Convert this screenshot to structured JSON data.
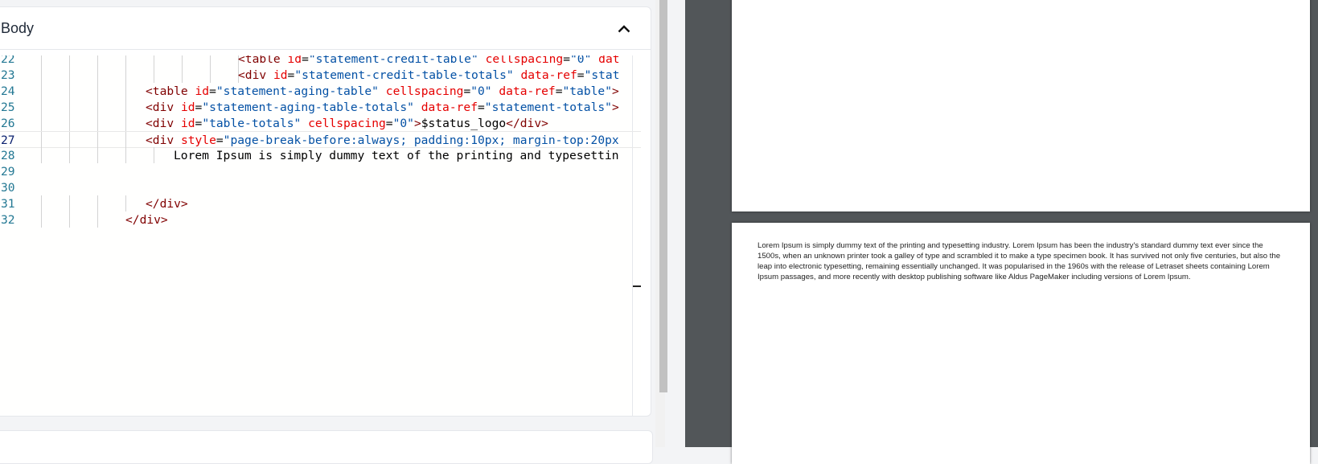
{
  "panel": {
    "title": "Body",
    "collapse_icon": "chevron-up-icon"
  },
  "editor": {
    "lines": [
      {
        "num": "22",
        "indent": 8,
        "parts": [
          {
            "t": "tag",
            "v": "<table "
          },
          {
            "t": "attr",
            "v": "id"
          },
          {
            "t": "txt",
            "v": "="
          },
          {
            "t": "val",
            "v": "\"statement-credit-table\""
          },
          {
            "t": "txt",
            "v": " "
          },
          {
            "t": "attr",
            "v": "cellspacing"
          },
          {
            "t": "txt",
            "v": "="
          },
          {
            "t": "val",
            "v": "\"0\""
          },
          {
            "t": "txt",
            "v": " "
          },
          {
            "t": "attr",
            "v": "dat"
          }
        ]
      },
      {
        "num": "23",
        "indent": 8,
        "parts": [
          {
            "t": "tag",
            "v": "<div "
          },
          {
            "t": "attr",
            "v": "id"
          },
          {
            "t": "txt",
            "v": "="
          },
          {
            "t": "val",
            "v": "\"statement-credit-table-totals\""
          },
          {
            "t": "txt",
            "v": " "
          },
          {
            "t": "attr",
            "v": "data-ref"
          },
          {
            "t": "txt",
            "v": "="
          },
          {
            "t": "val",
            "v": "\"stat"
          }
        ]
      },
      {
        "num": "24",
        "indent": 4,
        "parts": [
          {
            "t": "tag",
            "v": "<table "
          },
          {
            "t": "attr",
            "v": "id"
          },
          {
            "t": "txt",
            "v": "="
          },
          {
            "t": "val",
            "v": "\"statement-aging-table\""
          },
          {
            "t": "txt",
            "v": " "
          },
          {
            "t": "attr",
            "v": "cellspacing"
          },
          {
            "t": "txt",
            "v": "="
          },
          {
            "t": "val",
            "v": "\"0\""
          },
          {
            "t": "txt",
            "v": " "
          },
          {
            "t": "attr",
            "v": "data-ref"
          },
          {
            "t": "txt",
            "v": "="
          },
          {
            "t": "val",
            "v": "\"table\""
          },
          {
            "t": "tag",
            "v": ">"
          }
        ]
      },
      {
        "num": "25",
        "indent": 4,
        "parts": [
          {
            "t": "tag",
            "v": "<div "
          },
          {
            "t": "attr",
            "v": "id"
          },
          {
            "t": "txt",
            "v": "="
          },
          {
            "t": "val",
            "v": "\"statement-aging-table-totals\""
          },
          {
            "t": "txt",
            "v": " "
          },
          {
            "t": "attr",
            "v": "data-ref"
          },
          {
            "t": "txt",
            "v": "="
          },
          {
            "t": "val",
            "v": "\"statement-totals\""
          },
          {
            "t": "tag",
            "v": ">"
          }
        ]
      },
      {
        "num": "26",
        "indent": 4,
        "parts": [
          {
            "t": "tag",
            "v": "<div "
          },
          {
            "t": "attr",
            "v": "id"
          },
          {
            "t": "txt",
            "v": "="
          },
          {
            "t": "val",
            "v": "\"table-totals\""
          },
          {
            "t": "txt",
            "v": " "
          },
          {
            "t": "attr",
            "v": "cellspacing"
          },
          {
            "t": "txt",
            "v": "="
          },
          {
            "t": "val",
            "v": "\"0\""
          },
          {
            "t": "tag",
            "v": ">"
          },
          {
            "t": "txt",
            "v": "$status_logo"
          },
          {
            "t": "tag",
            "v": "</div>"
          }
        ]
      },
      {
        "num": "27",
        "indent": 4,
        "active": true,
        "parts": [
          {
            "t": "tag",
            "v": "<div "
          },
          {
            "t": "attr",
            "v": "style"
          },
          {
            "t": "txt",
            "v": "="
          },
          {
            "t": "val",
            "v": "\"page-break-before:always; padding:10px; margin-top:20px"
          }
        ]
      },
      {
        "num": "28",
        "indent": 5,
        "parts": [
          {
            "t": "txt",
            "v": "Lorem Ipsum is simply dummy text of the printing and typesettin"
          }
        ]
      },
      {
        "num": "29",
        "indent": 0,
        "parts": []
      },
      {
        "num": "30",
        "indent": 0,
        "parts": []
      },
      {
        "num": "31",
        "indent": 4,
        "parts": [
          {
            "t": "tag",
            "v": "</div>"
          }
        ]
      },
      {
        "num": "32",
        "indent": 3,
        "parts": [
          {
            "t": "tag",
            "v": "</div>"
          }
        ]
      }
    ]
  },
  "preview": {
    "page2_text": "Lorem Ipsum is simply dummy text of the printing and typesetting industry. Lorem Ipsum has been the industry's standard dummy text ever since the 1500s, when an unknown printer took a galley of type and scrambled it to make a type specimen book. It has survived not only five centuries, but also the leap into electronic typesetting, remaining essentially unchanged. It was popularised in the 1960s with the release of Letraset sheets containing Lorem Ipsum passages, and more recently with desktop publishing software like Aldus PageMaker including versions of Lorem Ipsum."
  }
}
